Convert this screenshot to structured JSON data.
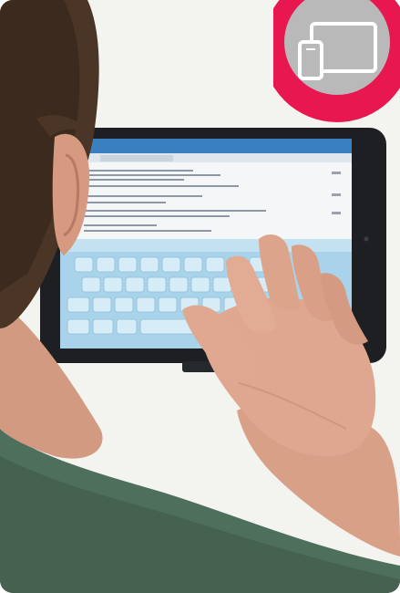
{
  "badge": {
    "icon": "devices-icon",
    "outer_color": "#e8174f",
    "inner_color": "#b9b9b9"
  },
  "scene": {
    "wall_color": "#eef0ea",
    "shirt_color": "#4f6f5d",
    "hair_color": "#4b3526",
    "skin_color": "#d9a088",
    "tablet_frame_color": "#1d1f22",
    "screen_color": "#f4f6f8",
    "keyboard_color": "#a9d3ea",
    "app_bar_color": "#3a7fc0"
  }
}
